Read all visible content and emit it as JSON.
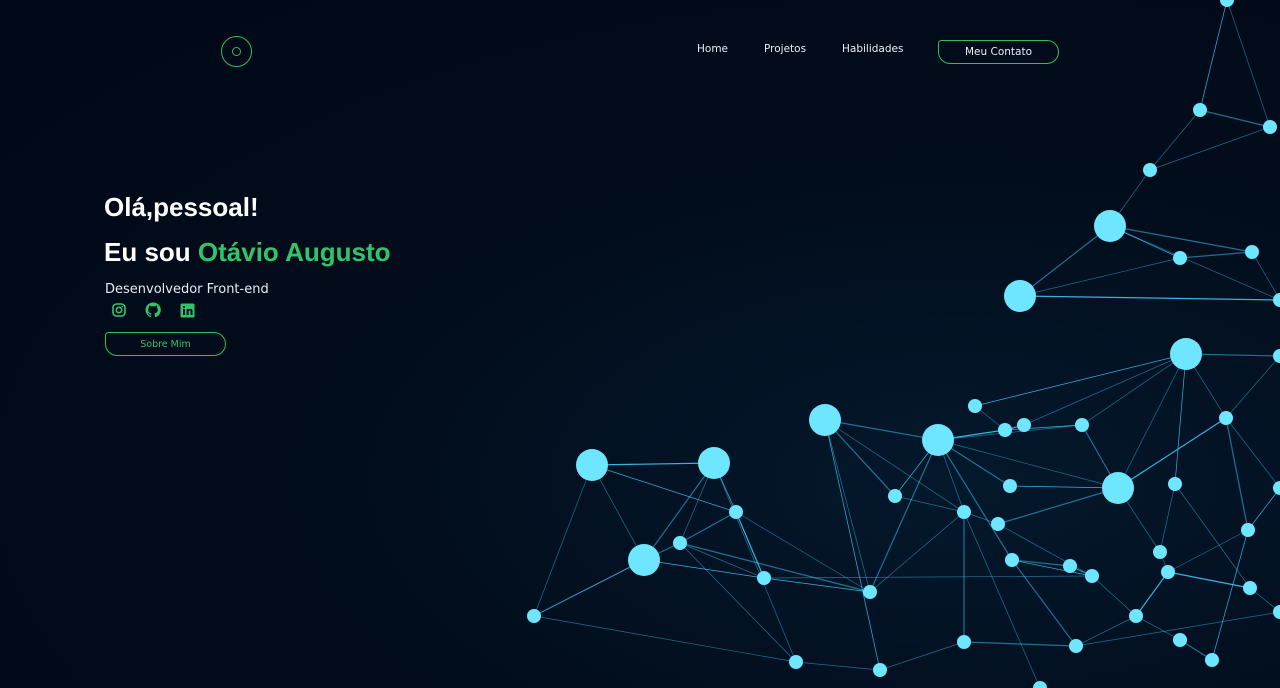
{
  "header": {
    "logo_icon": "circle-logo-icon",
    "nav": {
      "home": "Home",
      "projects": "Projetos",
      "skills": "Habilidades"
    },
    "contact_button": "Meu Contato"
  },
  "hero": {
    "greeting": "Olá,pessoal!",
    "intro_prefix": "Eu sou ",
    "name": "Otávio Augusto",
    "role": "Desenvolvedor Front-end",
    "socials": [
      "instagram-icon",
      "github-icon",
      "linkedin-icon"
    ],
    "about_button": "Sobre Mim"
  },
  "colors": {
    "background": "#020b1a",
    "accent": "#33c46b",
    "network": "#3fd0ff",
    "text": "#ffffff"
  }
}
